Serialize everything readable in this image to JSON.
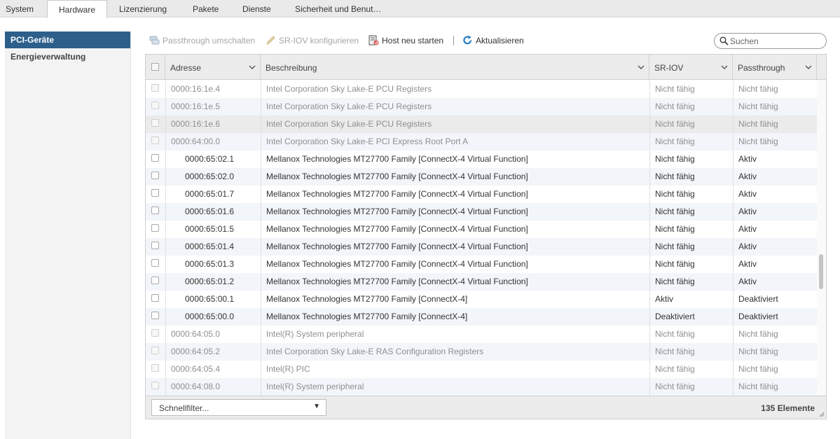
{
  "tabs": [
    {
      "label": "System",
      "active": false
    },
    {
      "label": "Hardware",
      "active": true
    },
    {
      "label": "Lizenzierung",
      "active": false
    },
    {
      "label": "Pakete",
      "active": false
    },
    {
      "label": "Dienste",
      "active": false
    },
    {
      "label": "Sicherheit und Benut…",
      "active": false
    }
  ],
  "sidebar": {
    "items": [
      {
        "label": "PCI-Geräte",
        "active": true
      },
      {
        "label": "Energieverwaltung",
        "active": false
      }
    ]
  },
  "toolbar": {
    "passthrough_label": "Passthrough umschalten",
    "sriov_label": "SR-IOV konfigurieren",
    "restart_label": "Host neu starten",
    "refresh_label": "Aktualisieren",
    "search_placeholder": "Suchen"
  },
  "grid": {
    "columns": {
      "address": "Adresse",
      "description": "Beschreibung",
      "sriov": "SR-IOV",
      "passthrough": "Passthrough"
    },
    "rows": [
      {
        "address": "0000:16:1e.4",
        "description": "Intel Corporation Sky Lake-E PCU Registers",
        "sriov": "Nicht fähig",
        "passthrough": "Nicht fähig",
        "enabled": false,
        "child": false
      },
      {
        "address": "0000:16:1e.5",
        "description": "Intel Corporation Sky Lake-E PCU Registers",
        "sriov": "Nicht fähig",
        "passthrough": "Nicht fähig",
        "enabled": false,
        "child": false
      },
      {
        "address": "0000:16:1e.6",
        "description": "Intel Corporation Sky Lake-E PCU Registers",
        "sriov": "Nicht fähig",
        "passthrough": "Nicht fähig",
        "enabled": false,
        "child": false
      },
      {
        "address": "0000:64:00.0",
        "description": "Intel Corporation Sky Lake-E PCI Express Root Port A",
        "sriov": "Nicht fähig",
        "passthrough": "Nicht fähig",
        "enabled": false,
        "child": false
      },
      {
        "address": "0000:65:02.1",
        "description": "Mellanox Technologies MT27700 Family [ConnectX-4 Virtual Function]",
        "sriov": "Nicht fähig",
        "passthrough": "Aktiv",
        "enabled": true,
        "child": true
      },
      {
        "address": "0000:65:02.0",
        "description": "Mellanox Technologies MT27700 Family [ConnectX-4 Virtual Function]",
        "sriov": "Nicht fähig",
        "passthrough": "Aktiv",
        "enabled": true,
        "child": true
      },
      {
        "address": "0000:65:01.7",
        "description": "Mellanox Technologies MT27700 Family [ConnectX-4 Virtual Function]",
        "sriov": "Nicht fähig",
        "passthrough": "Aktiv",
        "enabled": true,
        "child": true
      },
      {
        "address": "0000:65:01.6",
        "description": "Mellanox Technologies MT27700 Family [ConnectX-4 Virtual Function]",
        "sriov": "Nicht fähig",
        "passthrough": "Aktiv",
        "enabled": true,
        "child": true
      },
      {
        "address": "0000:65:01.5",
        "description": "Mellanox Technologies MT27700 Family [ConnectX-4 Virtual Function]",
        "sriov": "Nicht fähig",
        "passthrough": "Aktiv",
        "enabled": true,
        "child": true
      },
      {
        "address": "0000:65:01.4",
        "description": "Mellanox Technologies MT27700 Family [ConnectX-4 Virtual Function]",
        "sriov": "Nicht fähig",
        "passthrough": "Aktiv",
        "enabled": true,
        "child": true
      },
      {
        "address": "0000:65:01.3",
        "description": "Mellanox Technologies MT27700 Family [ConnectX-4 Virtual Function]",
        "sriov": "Nicht fähig",
        "passthrough": "Aktiv",
        "enabled": true,
        "child": true
      },
      {
        "address": "0000:65:01.2",
        "description": "Mellanox Technologies MT27700 Family [ConnectX-4 Virtual Function]",
        "sriov": "Nicht fähig",
        "passthrough": "Aktiv",
        "enabled": true,
        "child": true
      },
      {
        "address": "0000:65:00.1",
        "description": "Mellanox Technologies MT27700 Family [ConnectX-4]",
        "sriov": "Aktiv",
        "passthrough": "Deaktiviert",
        "enabled": true,
        "child": true
      },
      {
        "address": "0000:65:00.0",
        "description": "Mellanox Technologies MT27700 Family [ConnectX-4]",
        "sriov": "Deaktiviert",
        "passthrough": "Deaktiviert",
        "enabled": true,
        "child": true
      },
      {
        "address": "0000:64:05.0",
        "description": "Intel(R) System peripheral",
        "sriov": "Nicht fähig",
        "passthrough": "Nicht fähig",
        "enabled": false,
        "child": false
      },
      {
        "address": "0000:64:05.2",
        "description": "Intel Corporation Sky Lake-E RAS Configuration Registers",
        "sriov": "Nicht fähig",
        "passthrough": "Nicht fähig",
        "enabled": false,
        "child": false
      },
      {
        "address": "0000:64:05.4",
        "description": "Intel(R) PIC",
        "sriov": "Nicht fähig",
        "passthrough": "Nicht fähig",
        "enabled": false,
        "child": false
      },
      {
        "address": "0000:64:08.0",
        "description": "Intel(R) System peripheral",
        "sriov": "Nicht fähig",
        "passthrough": "Nicht fähig",
        "enabled": false,
        "child": false
      }
    ],
    "filter_placeholder": "Schnellfilter...",
    "item_count": "135 Elemente"
  },
  "colors": {
    "sidebar_active": "#2d5f8a",
    "refresh_icon": "#2b7bc2",
    "row_alt": "#f2f5f9"
  }
}
